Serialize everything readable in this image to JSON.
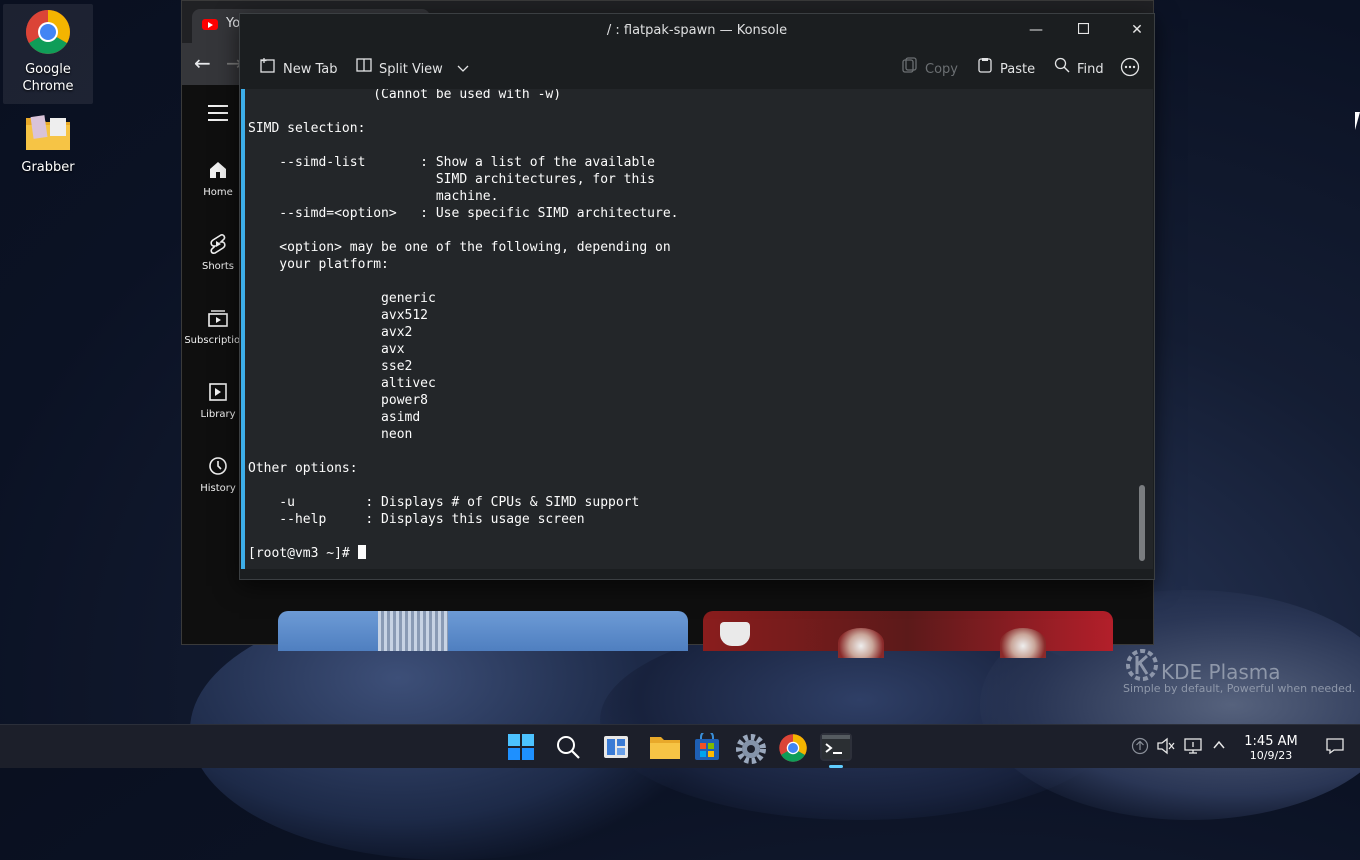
{
  "desktop": {
    "icons": [
      {
        "label_line1": "Google",
        "label_line2": "Chrome"
      },
      {
        "label_line1": "Grabber"
      }
    ]
  },
  "browser": {
    "tab_title": "Yo",
    "sidebar": [
      {
        "label": "Home",
        "icon": "home-icon"
      },
      {
        "label": "Shorts",
        "icon": "shorts-icon"
      },
      {
        "label": "Subscriptions",
        "icon": "subscriptions-icon"
      },
      {
        "label": "Library",
        "icon": "library-icon"
      },
      {
        "label": "History",
        "icon": "history-icon"
      }
    ]
  },
  "konsole": {
    "title": "/ : flatpak-spawn — Konsole",
    "toolbar": {
      "new_tab": "New Tab",
      "split_view": "Split View",
      "copy": "Copy",
      "paste": "Paste",
      "find": "Find"
    },
    "terminal_lines": [
      "                (Cannot be used with -w)",
      "",
      "SIMD selection:",
      "",
      "    --simd-list       : Show a list of the available",
      "                        SIMD architectures, for this",
      "                        machine.",
      "    --simd=<option>   : Use specific SIMD architecture.",
      "",
      "    <option> may be one of the following, depending on",
      "    your platform:",
      "",
      "                 generic",
      "                 avx512",
      "                 avx2",
      "                 avx",
      "                 sse2",
      "                 altivec",
      "                 power8",
      "                 asimd",
      "                 neon",
      "",
      "Other options:",
      "",
      "    -u         : Displays # of CPUs & SIMD support",
      "    --help     : Displays this usage screen",
      ""
    ],
    "prompt": "[root@vm3 ~]# "
  },
  "watermark": {
    "title": "KDE Plasma",
    "tagline": "Simple by default, Powerful when  needed."
  },
  "taskbar": {
    "time": "1:45 AM",
    "date": "10/9/23"
  }
}
